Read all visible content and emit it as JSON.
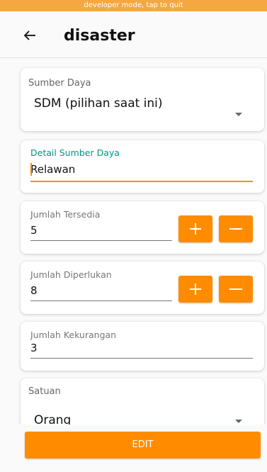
{
  "dev_banner": "developer mode, tap to quit",
  "appbar": {
    "title": "disaster"
  },
  "form": {
    "sumber_daya": {
      "label": "Sumber Daya",
      "value": "SDM (pilihan saat ini)"
    },
    "detail_sumber_daya": {
      "label": "Detail Sumber Daya",
      "value": "Relawan"
    },
    "jumlah_tersedia": {
      "label": "Jumlah Tersedia",
      "value": "5"
    },
    "jumlah_diperlukan": {
      "label": "Jumlah Diperlukan",
      "value": "8"
    },
    "jumlah_kekurangan": {
      "label": "Jumlah Kekurangan",
      "value": "3"
    },
    "satuan": {
      "label": "Satuan",
      "value": "Orang"
    }
  },
  "edit_button": "EDIT",
  "colors": {
    "accent": "#ff8c00",
    "banner": "#f5a742",
    "focus_label": "#009688"
  },
  "icons": {
    "back": "arrow-left-icon",
    "plus": "plus-icon",
    "minus": "minus-icon",
    "dropdown": "caret-down-icon"
  }
}
